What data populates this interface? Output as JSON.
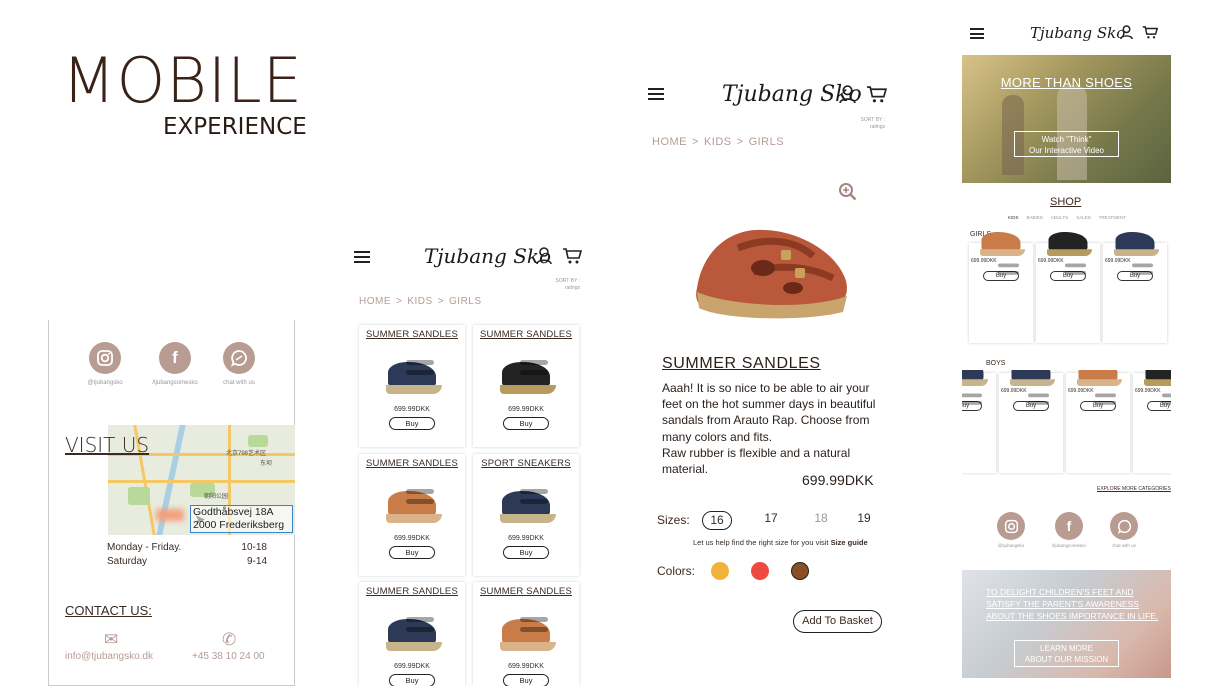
{
  "title": {
    "main": "MOBILE",
    "sub": "EXPERIENCE"
  },
  "brand": "Tjubang Sko",
  "breadcrumb": [
    "HOME",
    "KIDS",
    "GIRLS"
  ],
  "sort_by": {
    "label": "SORT BY :",
    "value": "ratings"
  },
  "contact": {
    "socials": [
      {
        "icon": "instagram-icon",
        "handle": "@tjubangsko"
      },
      {
        "icon": "facebook-icon",
        "handle": "/tjubangsomesko"
      },
      {
        "icon": "chat-icon",
        "handle": "chat with us"
      }
    ],
    "visit_us": "VISIT US",
    "map_address": [
      "Godthåbsvej 18A",
      "2000 Frederiksberg"
    ],
    "map_labels": [
      "北京798艺术区",
      "朝阳公园",
      "东坝"
    ],
    "hours": [
      {
        "days": "Monday - Friday.",
        "time": "10-18"
      },
      {
        "days": "Saturday",
        "time": "9-14"
      }
    ],
    "contact_us": "CONTACT US:",
    "email": "info@tjubangsko.dk",
    "phone": "+45 38 10 24 00"
  },
  "grid": {
    "products": [
      {
        "name": "SUMMER SANDLES",
        "price": "699.99DKK",
        "buy": "Buy",
        "color": "navy"
      },
      {
        "name": "SUMMER SANDLES",
        "price": "699.99DKK",
        "buy": "Buy",
        "color": "black"
      },
      {
        "name": "SUMMER SANDLES",
        "price": "699.99DKK",
        "buy": "Buy",
        "color": "tan"
      },
      {
        "name": "SPORT SNEAKERS",
        "price": "699.99DKK",
        "buy": "Buy",
        "color": "navy"
      },
      {
        "name": "SUMMER SANDLES",
        "price": "699.99DKK",
        "buy": "Buy",
        "color": "navy"
      },
      {
        "name": "SUMMER SANDLES",
        "price": "699.99DKK",
        "buy": "Buy",
        "color": "tan"
      }
    ]
  },
  "detail": {
    "name": "SUMMER SANDLES",
    "description": "Aaah! It is so nice to be able to air your feet on the hot summer days in beautiful sandals from Arauto Rap. Choose from many colors and fits.\nRaw rubber is flexible and a natural material.",
    "price": "699.99DKK",
    "sizes_label": "Sizes:",
    "sizes": [
      "16",
      "17",
      "18",
      "19"
    ],
    "selected_size": "16",
    "size_guide_text": "Let us help find the right size for you visit",
    "size_guide_link": "Size guide",
    "colors_label": "Colors:",
    "colors": [
      "#f2b33d",
      "#ee4a43",
      "#8a4f22"
    ],
    "add_to_basket": "Add To Basket"
  },
  "home": {
    "hero_title": "MORE THAN SHOES",
    "hero_button": [
      "Watch \"Think\"",
      "Our Interactive Video"
    ],
    "shop_title": "SHOP",
    "shop_categories": [
      "KIDS",
      "BABIES",
      "ADULTS",
      "SALES",
      "TREATMENT"
    ],
    "girls_label": "GIRLS",
    "girls": [
      {
        "name": "SANDLES",
        "price": "699.99DKK",
        "buy": "Buy",
        "color": "tan"
      },
      {
        "name": "SANDLES",
        "price": "699.99DKK",
        "buy": "Buy",
        "color": "black"
      },
      {
        "name": "SNEAKERS",
        "price": "699.99DKK",
        "buy": "Buy",
        "color": "navy"
      }
    ],
    "boys_label": "BOYS",
    "boys": [
      {
        "name": "NDLES",
        "price": "KK",
        "buy": "Buy",
        "color": "navy"
      },
      {
        "name": "SNEAKERS",
        "price": "699.99DKK",
        "buy": "Buy",
        "color": "navy"
      },
      {
        "name": "SANDLES",
        "price": "699.99DKK",
        "buy": "Buy",
        "color": "tan"
      },
      {
        "name": "SANI",
        "price": "699.99DKK",
        "buy": "Buy",
        "color": "black"
      }
    ],
    "explore_more": "EXPLORE MORE CATEGORIES",
    "footer_text": [
      "TO DELIGHT CHILDREN'S FEET AND",
      "SATISFY THE PARENT'S AWARENESS",
      "ABOUT THE SHOES IMPORTANCE IN LIFE."
    ],
    "footer_button": [
      "LEARN MORE",
      "ABOUT OUR MISSION"
    ]
  }
}
